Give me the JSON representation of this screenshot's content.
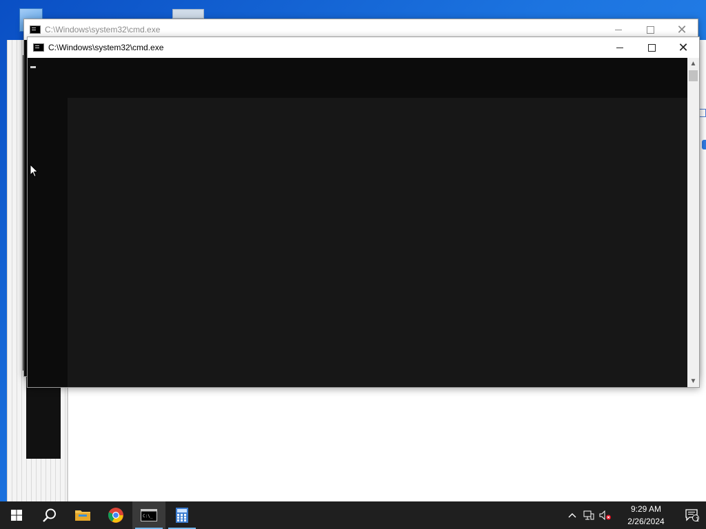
{
  "windows": {
    "back": {
      "title": "C:\\Windows\\system32\\cmd.exe"
    },
    "front": {
      "title": "C:\\Windows\\system32\\cmd.exe"
    }
  },
  "taskbar": {
    "apps": [
      {
        "name": "start",
        "icon": "windows-logo-icon"
      },
      {
        "name": "search",
        "icon": "search-icon"
      },
      {
        "name": "file-explorer",
        "icon": "folder-icon"
      },
      {
        "name": "chrome",
        "icon": "chrome-icon"
      },
      {
        "name": "cmd",
        "icon": "terminal-icon",
        "active": true
      },
      {
        "name": "calculator",
        "icon": "calculator-icon"
      }
    ],
    "clock": {
      "time": "9:29 AM",
      "date": "2/26/2024"
    },
    "notification_count": "1"
  },
  "colors": {
    "taskbar": "#1f1f1f",
    "console": "#0c0c0c",
    "accent": "#76b9ed"
  }
}
